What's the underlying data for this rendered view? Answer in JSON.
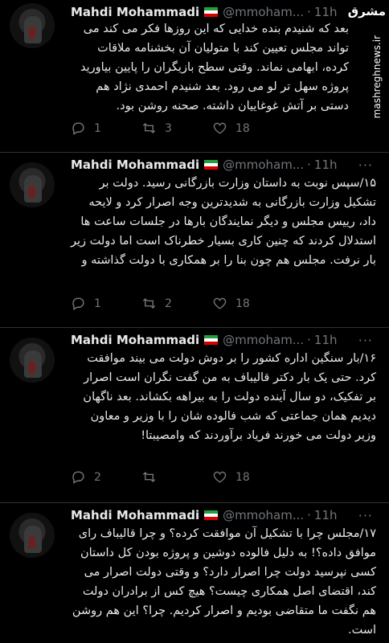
{
  "watermark": {
    "logo": "مشرق",
    "site": "mashreghnews.ir"
  },
  "tweets": [
    {
      "name": "Mahdi Mohammadi",
      "handle": "@mmoham...",
      "dot": "·",
      "time": "11h",
      "text": "بعد که شنیدم بنده خدایی که این روزها فکر می کند می تواند مجلس تعیین کند با متولیان آن بخشنامه ملاقات کرده، ابهامی نماند. وقتی سطح بازیگران را پایین بیاورید پروژه سهل تر لو می رود. بعد شنیدم احمدی نژاد هم دستی بر آتش غوغاییان داشته. صحنه روشن بود.",
      "replies": "1",
      "retweets": "3",
      "likes": "18"
    },
    {
      "name": "Mahdi Mohammadi",
      "handle": "@mmoham...",
      "dot": "·",
      "time": "11h",
      "text": "۱۵/سپس نوبت به داستان وزارت بازرگانی رسید. دولت بر تشکیل وزارت بازرگانی به شدیدترین وجه اصرار کرد و لایحه داد، رییس مجلس و دیگر نمایندگان بارها در جلسات ساعت ها استدلال کردند که چنین کاری بسیار خطرناک است اما دولت زیر بار نرفت. مجلس هم چون بنا را بر همکاری با دولت گذاشته و",
      "replies": "1",
      "retweets": "2",
      "likes": "18"
    },
    {
      "name": "Mahdi Mohammadi",
      "handle": "@mmoham...",
      "dot": "·",
      "time": "11h",
      "text": "۱۶/بار سنگین اداره کشور را بر دوش دولت می بیند موافقت کرد. حتی یک بار دکتر قالیباف به من گفت نگران است اصرار بر تفکیک، دو سال آینده دولت را به بیراهه بکشاند. بعد ناگهان دیدیم همان جماعتی که شب فالوده شان را با وزیر و معاون وزیر دولت می خورند فریاد برآوردند که وامصیبتا!",
      "replies": "2",
      "retweets": "",
      "likes": "18"
    },
    {
      "name": "Mahdi Mohammadi",
      "handle": "@mmoham...",
      "dot": "·",
      "time": "11h",
      "text": "۱۷/مجلس چرا با تشکیل آن موافقت کرده؟ و چرا قالیباف رای موافق داده؟! به دلیل فالوده دوشین و پروژه بودن کل داستان کسی نپرسید دولت چرا اصرار دارد؟ و وقتی دولت اصرار می کند، اقتضای اصل همکاری چیست؟ هیچ کس از برادران دولت هم نگفت ما متقاضی بودیم و اصرار کردیم. چرا؟ این هم روشن است.",
      "replies": "",
      "retweets": "",
      "likes": ""
    }
  ],
  "icons": {
    "reply": "reply-icon",
    "retweet": "retweet-icon",
    "like": "like-icon",
    "more": "more-icon"
  },
  "colors": {
    "background": "#000000",
    "text": "#e7e9ea",
    "muted": "#71767b",
    "divider": "#2f3336"
  }
}
